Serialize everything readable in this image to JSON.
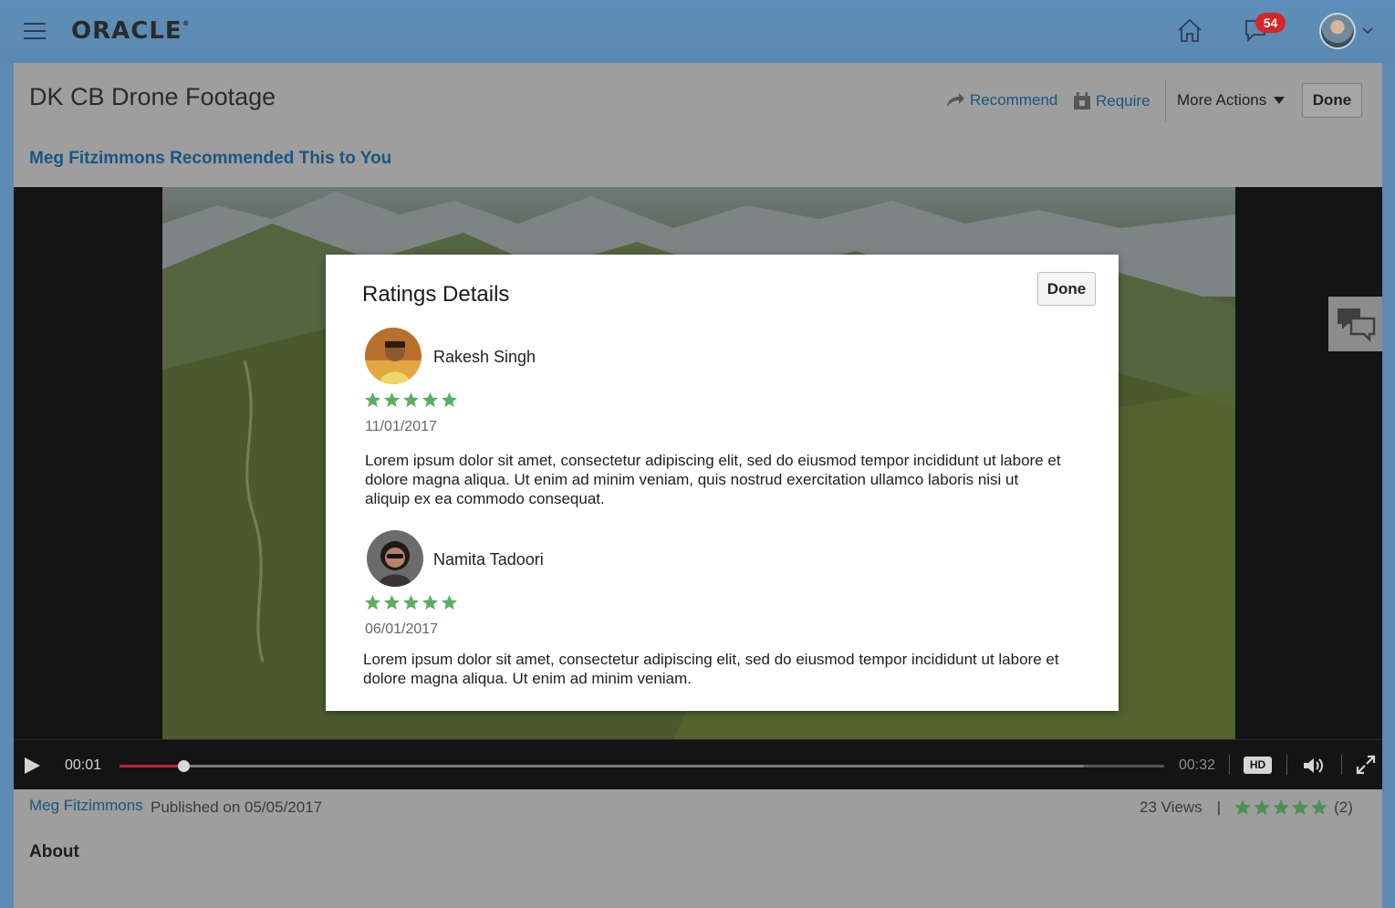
{
  "app": {
    "brand": "ORACLE",
    "notifications_count": "54"
  },
  "page": {
    "title": "DK CB Drone Footage",
    "actions": {
      "recommend": "Recommend",
      "require": "Require",
      "more": "More Actions",
      "done": "Done"
    },
    "recommended_banner": "Meg Fitzimmons Recommended This to You"
  },
  "video": {
    "current_time": "00:01",
    "total_time": "00:32",
    "progress": 0.061,
    "buffered": 0.923,
    "quality_label": "HD"
  },
  "meta": {
    "author": "Meg Fitzimmons",
    "published": "Published on 05/05/2017",
    "views": "23 Views",
    "separator": "|",
    "rating_count": "(2)",
    "rating_stars": 5
  },
  "about_heading": "About",
  "modal": {
    "title": "Ratings Details",
    "done_label": "Done",
    "reviews": [
      {
        "name": "Rakesh Singh",
        "stars": 5,
        "date": "11/01/2017",
        "text": "Lorem ipsum dolor sit amet, consectetur adipiscing elit, sed do eiusmod tempor incididunt ut labore et dolore magna aliqua. Ut enim ad minim veniam, quis nostrud exercitation ullamco laboris nisi ut aliquip ex ea commodo consequat."
      },
      {
        "name": "Namita Tadoori",
        "stars": 5,
        "date": "06/01/2017",
        "text": "Lorem ipsum dolor sit amet, consectetur adipiscing elit, sed do eiusmod tempor incididunt ut labore et dolore magna aliqua. Ut enim ad minim veniam."
      }
    ]
  },
  "colors": {
    "accent_link": "#1a5580",
    "star_green": "#5cae63",
    "progress_red": "#c0223b",
    "badge_red": "#d6262a"
  }
}
